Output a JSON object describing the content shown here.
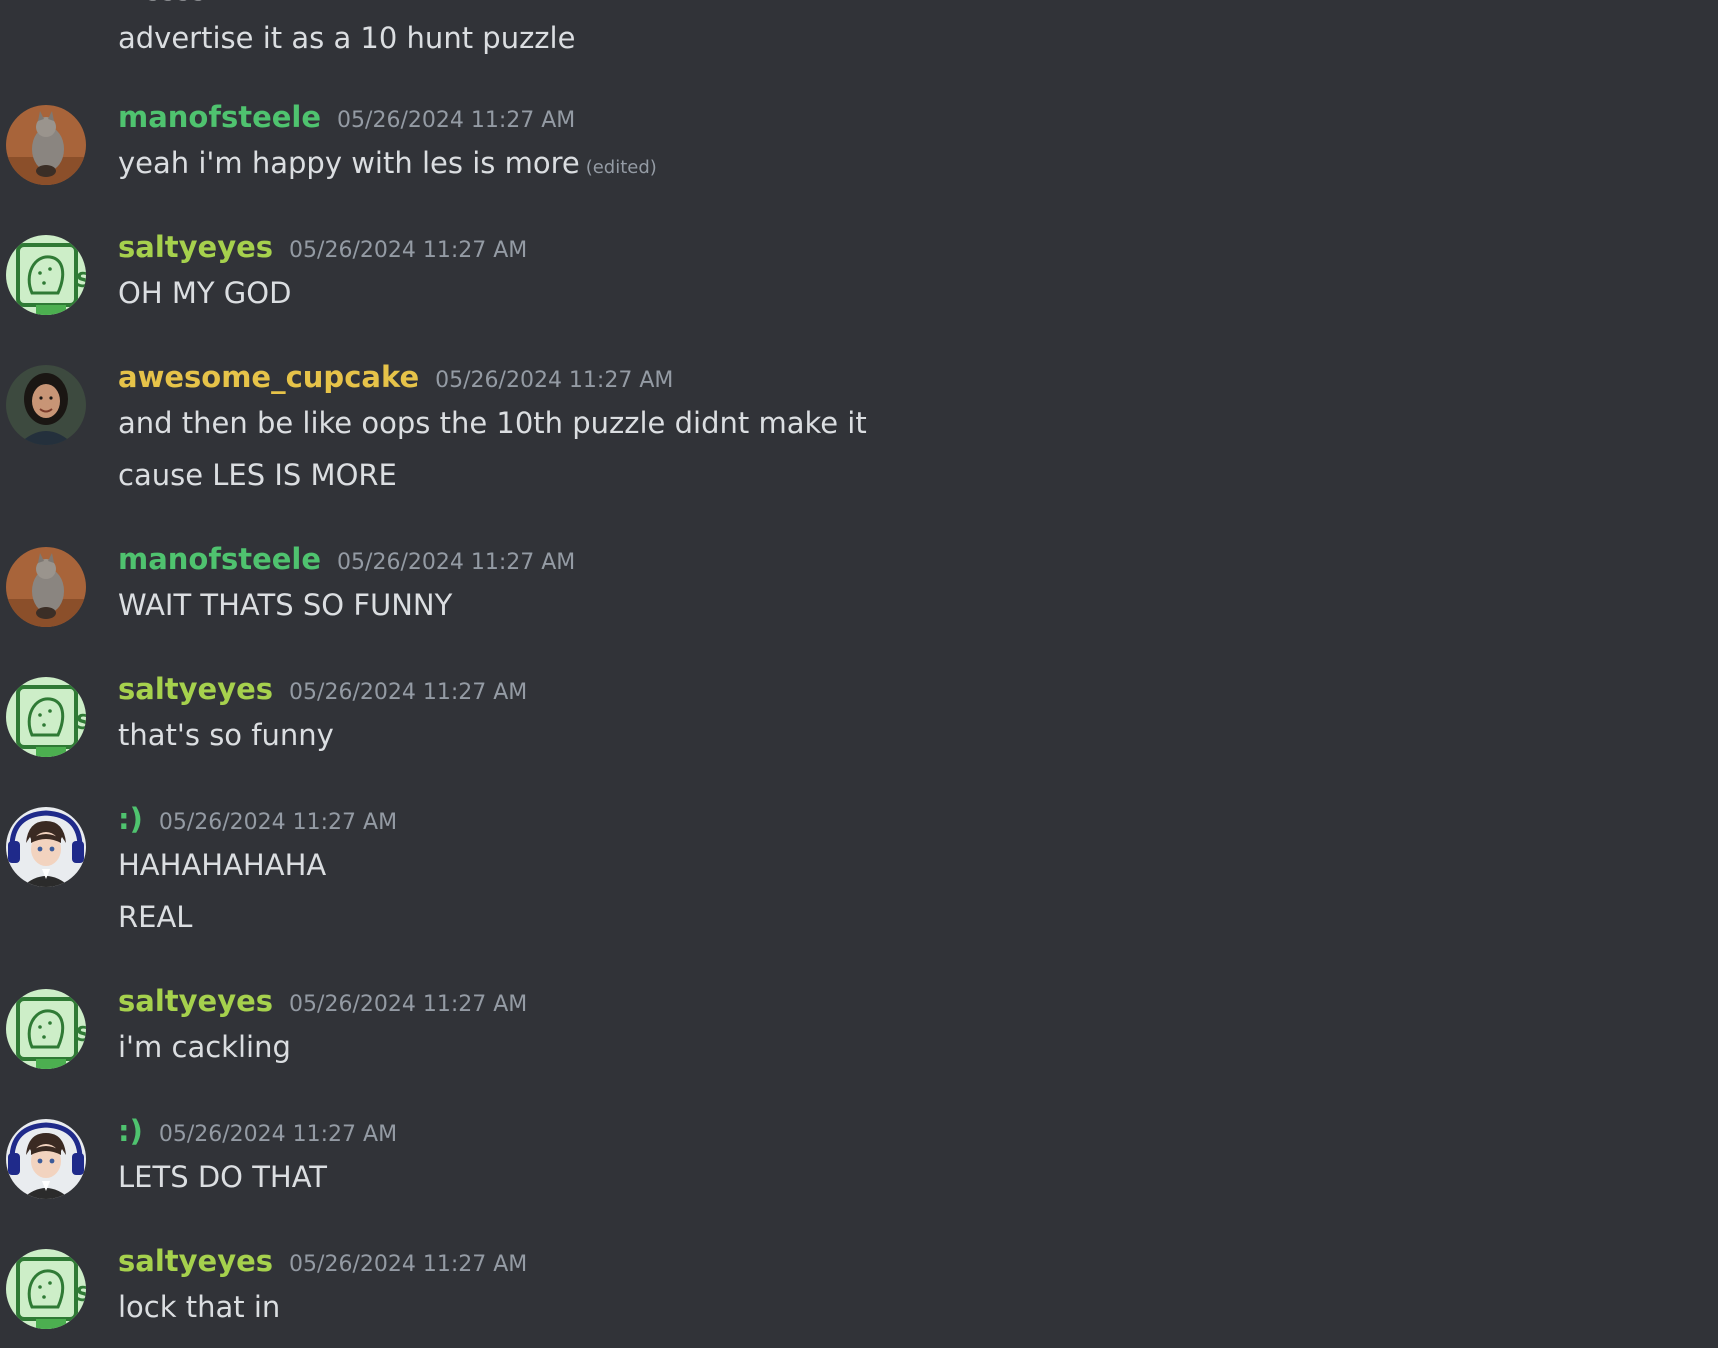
{
  "colors": {
    "background": "#313338",
    "text": "#dbdee1",
    "muted": "#949ba4",
    "manofsteele": "#4fc36f",
    "saltyeyes": "#a6d14d",
    "awesome_cupcake": "#e6c349",
    "smiley": "#4fc36f"
  },
  "partial": {
    "cut_text": "...ssss ... ...",
    "continuation": "advertise it as a 10 hunt puzzle"
  },
  "messages": [
    {
      "user": "manofsteele",
      "time": "05/26/2024 11:27 AM",
      "lines": [
        "yeah i'm happy with les is more"
      ],
      "edited": "(edited)",
      "avatar": "cat-avatar"
    },
    {
      "user": "saltyeyes",
      "time": "05/26/2024 11:27 AM",
      "lines": [
        "OH MY GOD"
      ],
      "avatar": "pickle-avatar"
    },
    {
      "user": "awesome_cupcake",
      "time": "05/26/2024 11:27 AM",
      "lines": [
        "and then be like oops the 10th puzzle didnt make it",
        "cause LES IS MORE"
      ],
      "avatar": "person-avatar"
    },
    {
      "user": "manofsteele",
      "time": "05/26/2024 11:27 AM",
      "lines": [
        "WAIT THATS SO FUNNY"
      ],
      "avatar": "cat-avatar"
    },
    {
      "user": "saltyeyes",
      "time": "05/26/2024 11:27 AM",
      "lines": [
        "that's so funny"
      ],
      "avatar": "pickle-avatar"
    },
    {
      "user": ":)",
      "time": "05/26/2024 11:27 AM",
      "lines": [
        "HAHAHAHAHA",
        "REAL"
      ],
      "avatar": "anime-avatar"
    },
    {
      "user": "saltyeyes",
      "time": "05/26/2024 11:27 AM",
      "lines": [
        "i'm cackling"
      ],
      "avatar": "pickle-avatar"
    },
    {
      "user": ":)",
      "time": "05/26/2024 11:27 AM",
      "lines": [
        "LETS DO THAT"
      ],
      "avatar": "anime-avatar"
    },
    {
      "user": "saltyeyes",
      "time": "05/26/2024 11:27 AM",
      "lines": [
        "lock that in"
      ],
      "avatar": "pickle-avatar"
    }
  ]
}
